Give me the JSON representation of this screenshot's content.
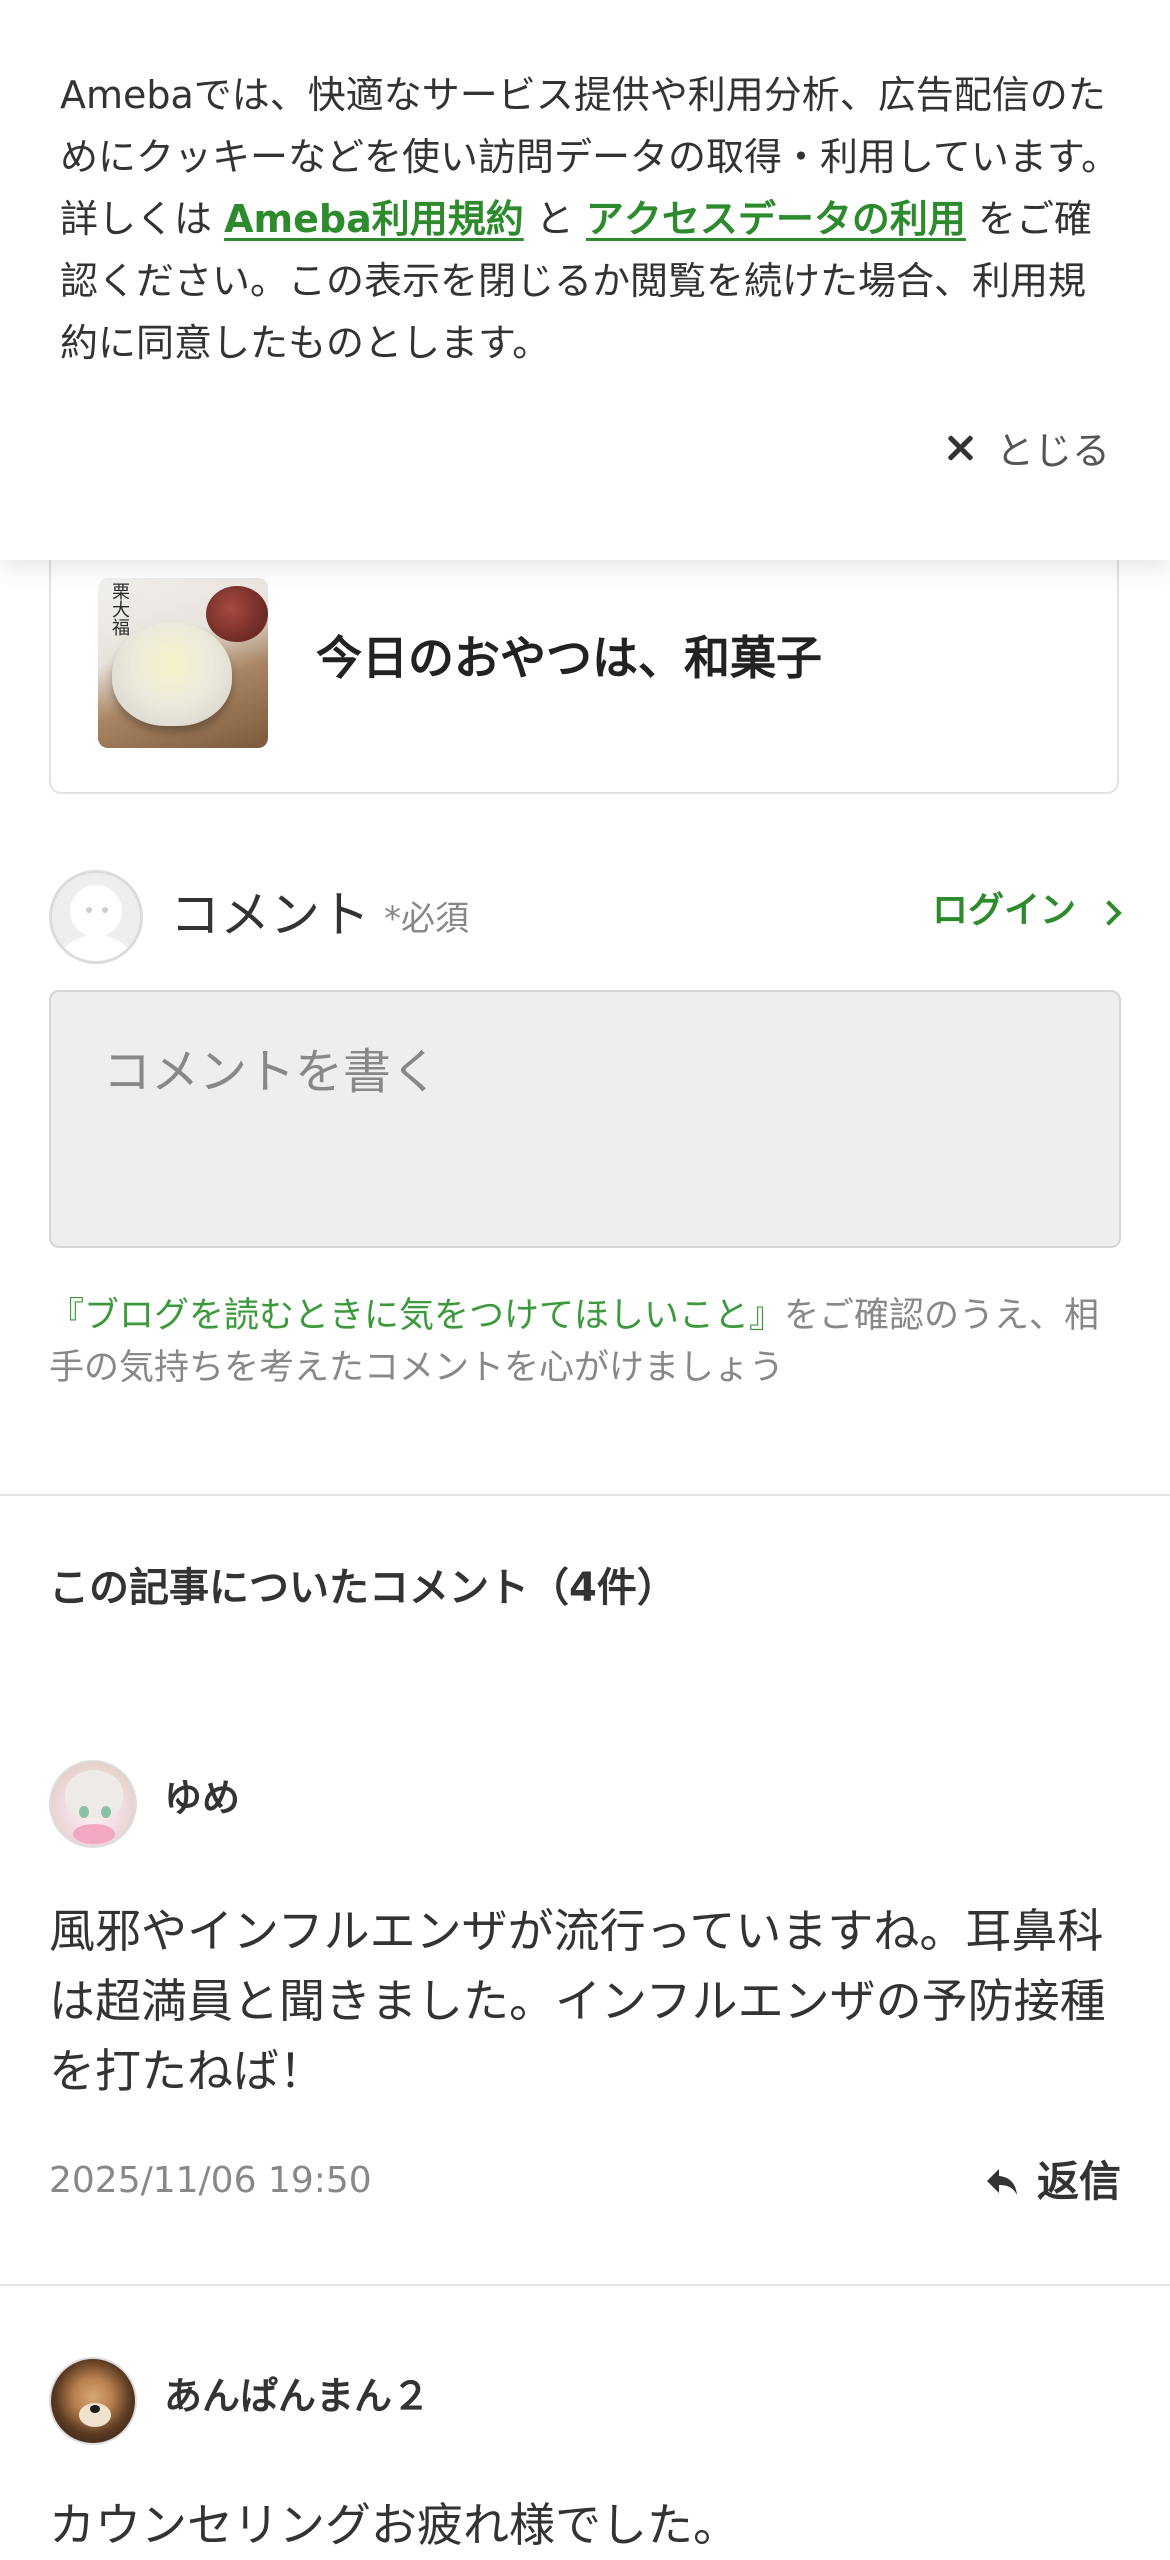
{
  "cookie_banner": {
    "text_before_link1": "Amebaでは、快適なサービス提供や利用分析、広告配信のためにクッキーなどを使い訪問データの取得・利用しています。詳しくは ",
    "link1": "Ameba利用規約",
    "text_between": " と ",
    "link2": "アクセスデータの利用",
    "text_after": " をご確認ください。この表示を閉じるか閲覧を続けた場合、利用規約に同意したものとします。",
    "close_label": "とじる"
  },
  "article": {
    "thumbnail_text": "栗大福",
    "title": "今日のおやつは、和菓子"
  },
  "comment_form": {
    "label": "コメント",
    "required": "*必須",
    "login": "ログイン",
    "placeholder": "コメントを書く",
    "guideline_link": "『ブログを読むときに気をつけてほしいこと』",
    "guideline_text": "をご確認のうえ、相手の気持ちを考えたコメントを心がけましょう"
  },
  "comments": {
    "heading": "この記事についたコメント（4件）",
    "items": [
      {
        "user": "ゆめ",
        "body": "風邪やインフルエンザが流行っていますね。耳鼻科は超満員と聞きました。インフルエンザの予防接種を打たねば！",
        "date": "2025/11/06 19:50",
        "reply_label": "返信"
      },
      {
        "user": "あんぱんまん２",
        "body": "カウンセリングお疲れ様でした。"
      }
    ]
  },
  "colors": {
    "accent_green": "#2d8a2d",
    "text_gray": "#888888"
  }
}
